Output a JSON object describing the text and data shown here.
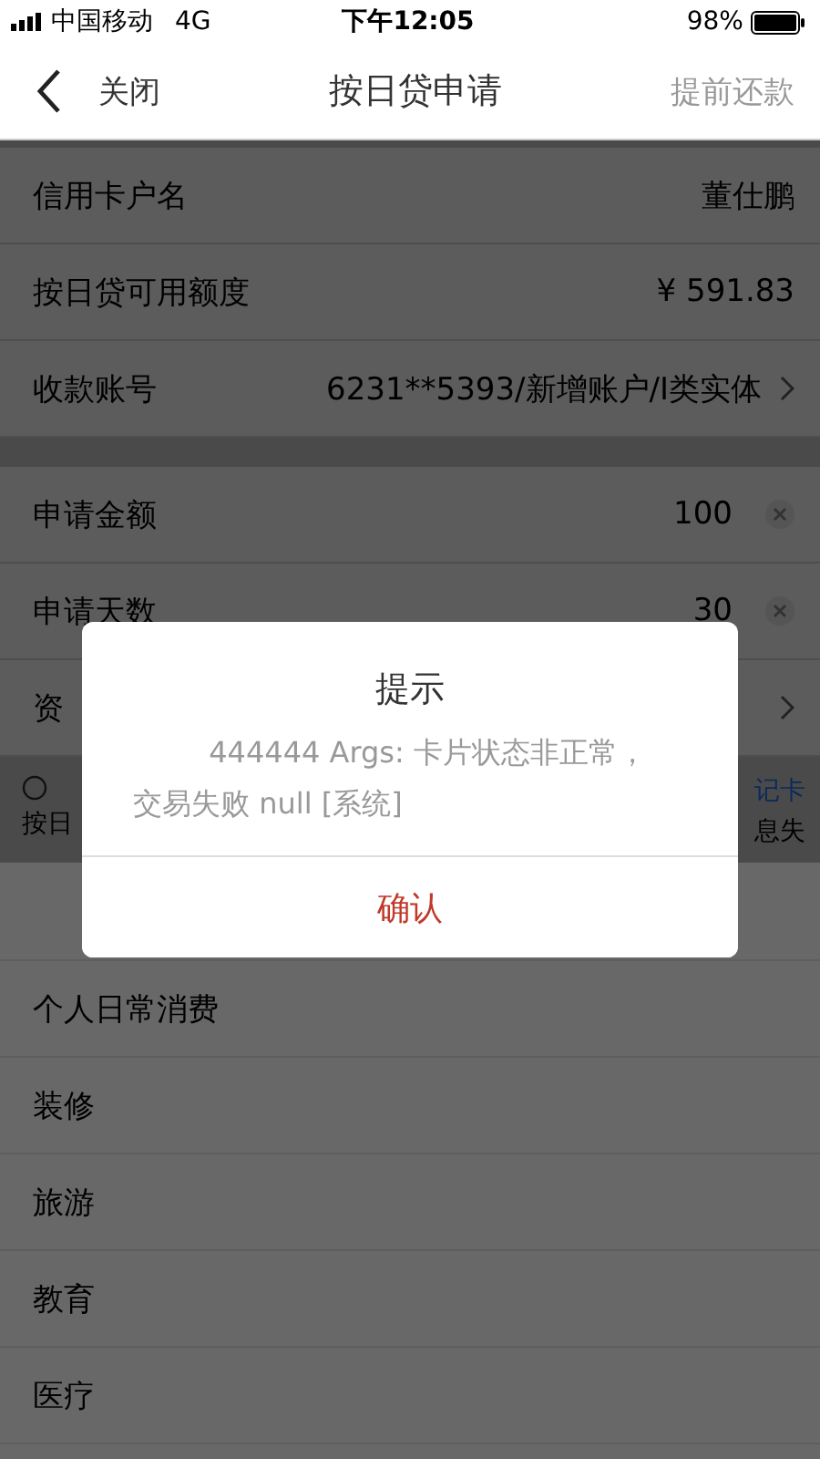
{
  "status_bar": {
    "carrier": "中国移动",
    "network": "4G",
    "time": "下午12:05",
    "battery": "98%"
  },
  "nav": {
    "back": "关闭",
    "title": "按日贷申请",
    "action": "提前还款"
  },
  "groups": [
    [
      {
        "label": "信用卡户名",
        "value": "董仕鹏",
        "kind": "text"
      },
      {
        "label": "按日贷可用额度",
        "value": "¥  591.83",
        "kind": "text"
      },
      {
        "label": "收款账号",
        "value": "6231**5393/新增账户/I类实体",
        "kind": "link"
      }
    ],
    [
      {
        "label": "申请金额",
        "value": "100",
        "kind": "clear"
      },
      {
        "label": "申请天数",
        "value": "30",
        "kind": "clear"
      },
      {
        "label": "资",
        "kind": "link"
      }
    ]
  ],
  "note": {
    "left": "按日",
    "right_top": "记卡",
    "right_bottom": "息失"
  },
  "options": [
    "个人日常消费",
    "装修",
    "旅游",
    "教育",
    "医疗"
  ],
  "dialog": {
    "title": "提示",
    "message": "444444 Args: 卡片状态非正常，交易失败 null [系统]",
    "button": "确认"
  }
}
